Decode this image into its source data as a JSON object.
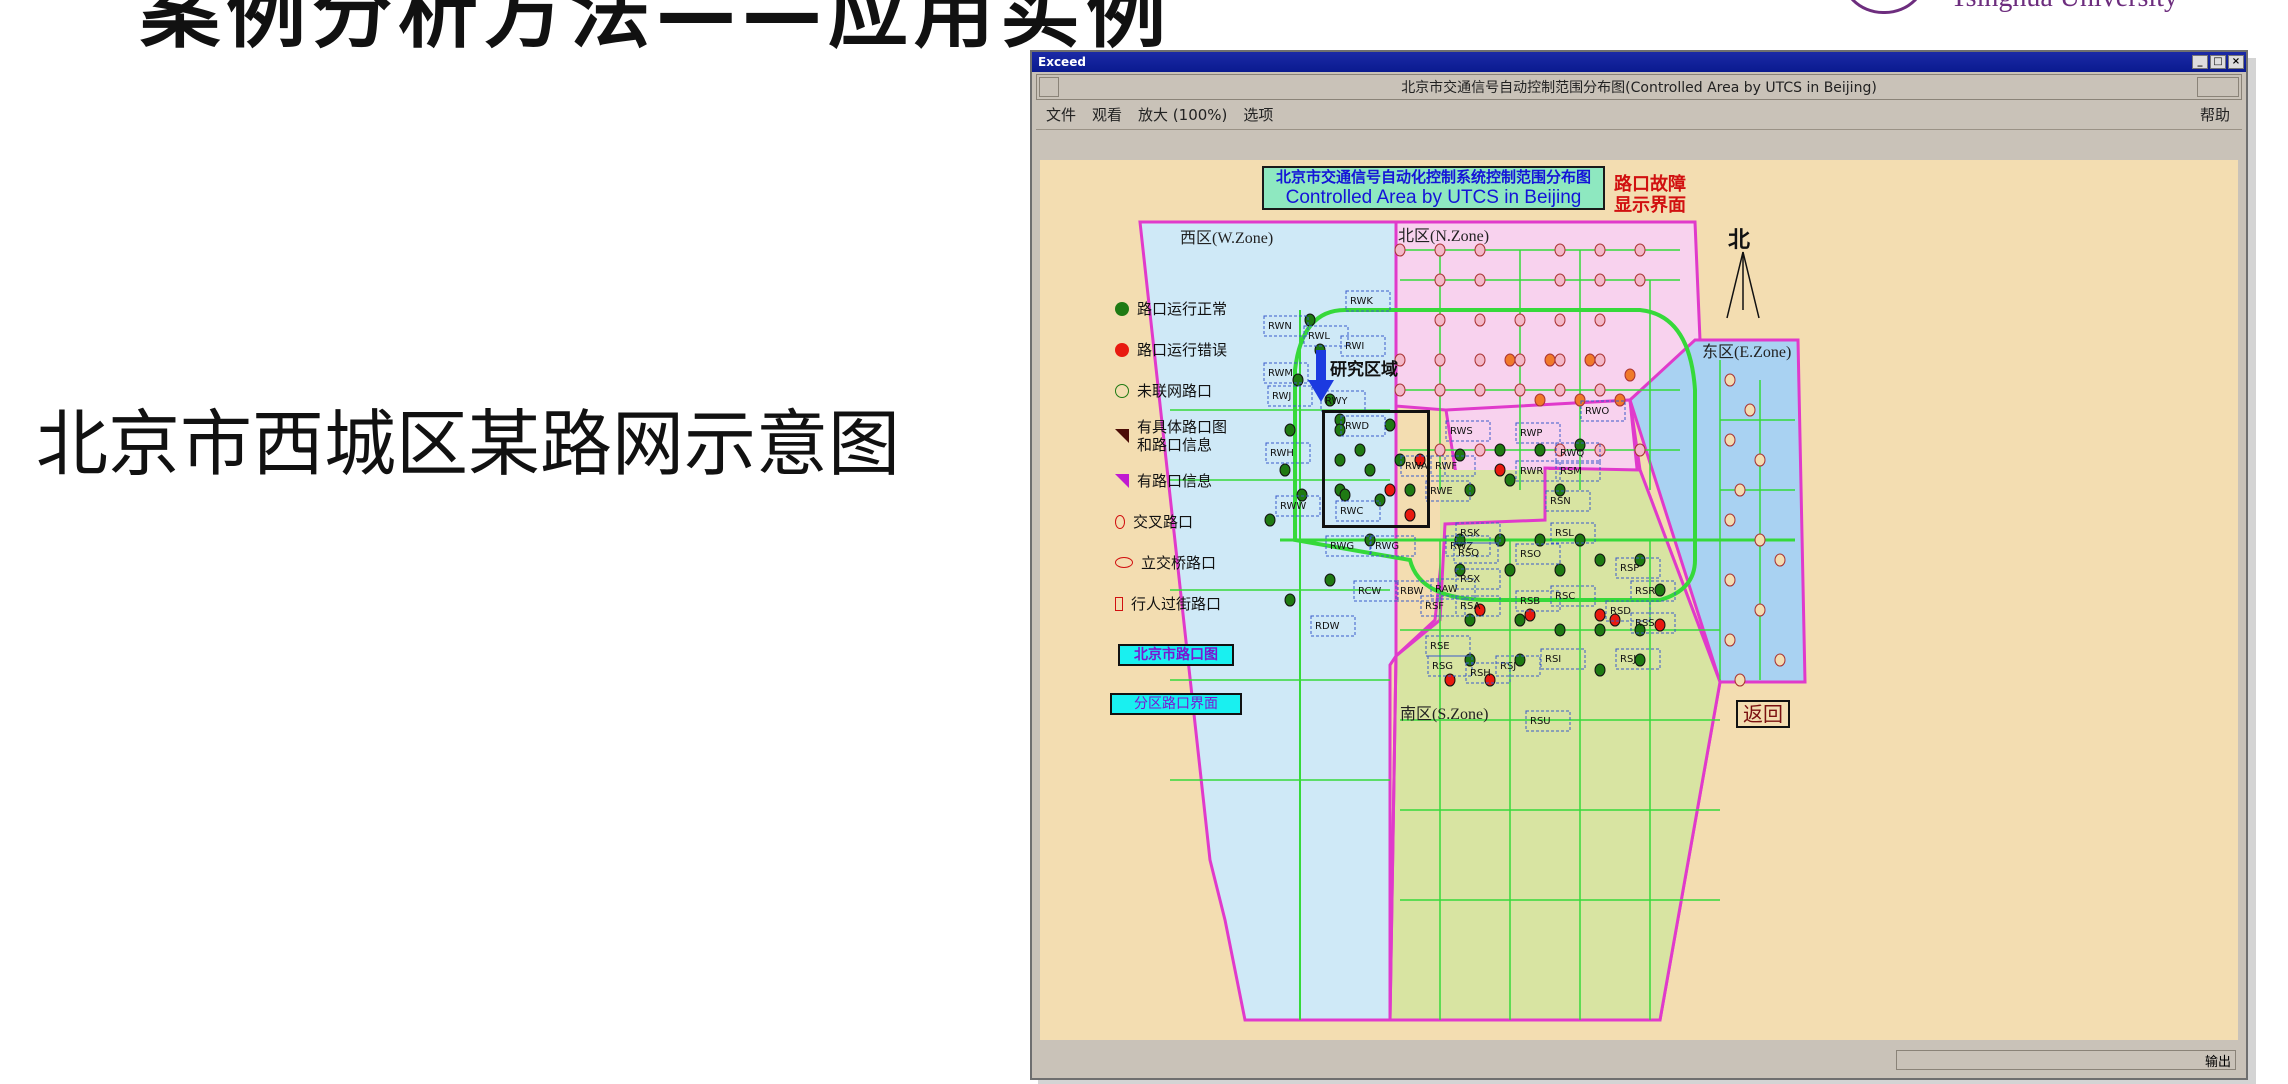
{
  "slide": {
    "title": "案例分析方法——应用实例",
    "logo_text": "Tsinghua University",
    "subtitle": "北京市西城区某路网示意图"
  },
  "window": {
    "x_title": "Exceed",
    "x_buttons": [
      "_",
      "□",
      "×"
    ],
    "app_title": "北京市交通信号自动控制范围分布图(Controlled Area by UTCS in Beijing)",
    "menu": {
      "file": "文件",
      "view": "观看",
      "zoom": "放大 (100%)",
      "options": "选项",
      "help": "帮助"
    },
    "status_text": "输出"
  },
  "map": {
    "title_cn": "北京市交通信号自动化控制系统控制范围分布图",
    "title_en": "Controlled Area by UTCS in Beijing",
    "fault_line1": "路口故障",
    "fault_line2": "显示界面",
    "north_label": "北",
    "study_area": "研究区域",
    "zones": {
      "west": "西区(W.Zone)",
      "north": "北区(N.Zone)",
      "east": "东区(E.Zone)",
      "south": "南区(S.Zone)"
    },
    "legend": [
      {
        "label": "路口运行正常",
        "icon": "green-dot"
      },
      {
        "label": "路口运行错误",
        "icon": "red-dot"
      },
      {
        "label": "未联网路口",
        "icon": "hollow-green-circle"
      },
      {
        "label": "有具体路口图\n和路口信息",
        "icon": "dark-red-triangle"
      },
      {
        "label": "有路口信息",
        "icon": "magenta-triangle"
      },
      {
        "label": "交叉路口",
        "icon": "small-hollow-red-ellipse"
      },
      {
        "label": "立交桥路口",
        "icon": "wide-hollow-red-ellipse"
      },
      {
        "label": "行人过街路口",
        "icon": "hollow-red-rect"
      }
    ],
    "buttons": {
      "city_map": "北京市路口图",
      "zone_view": "分区路口界面",
      "back": "返回"
    },
    "region_labels": [
      "RWK",
      "RWL",
      "RWN",
      "RWI",
      "RWM",
      "RWJ",
      "RWY",
      "RWD",
      "RWH",
      "RWA",
      "RWF",
      "RWS",
      "RWP",
      "RWQ",
      "RWO",
      "RWR",
      "RWE",
      "RWW",
      "RWC",
      "RWG",
      "RWG",
      "RWZ",
      "RCW",
      "RBW",
      "RAW",
      "RDW",
      "RSK",
      "RSQ",
      "RSX",
      "RSL",
      "RSO",
      "RSP",
      "RSN",
      "RSM",
      "RSF",
      "RSA",
      "RSB",
      "RSC",
      "RSD",
      "RSR",
      "RSS",
      "RSE",
      "RSJ",
      "RSG",
      "RSH",
      "RSI",
      "RSJ",
      "RSU"
    ]
  },
  "colors": {
    "canvas_bg": "#f3ddb1",
    "west_zone": "#cfe9f7",
    "north_zone": "#f8d2ee",
    "east_zone": "#a9d2f2",
    "south_zone": "#d8e4a2",
    "zone_border": "#e03acb",
    "road": "#36d93a",
    "node_ok": "#1f7a13",
    "node_err": "#e81a10",
    "title_box": "#8ee8c0",
    "button_cyan": "#19f0f0",
    "button_text": "#7a17d1"
  }
}
